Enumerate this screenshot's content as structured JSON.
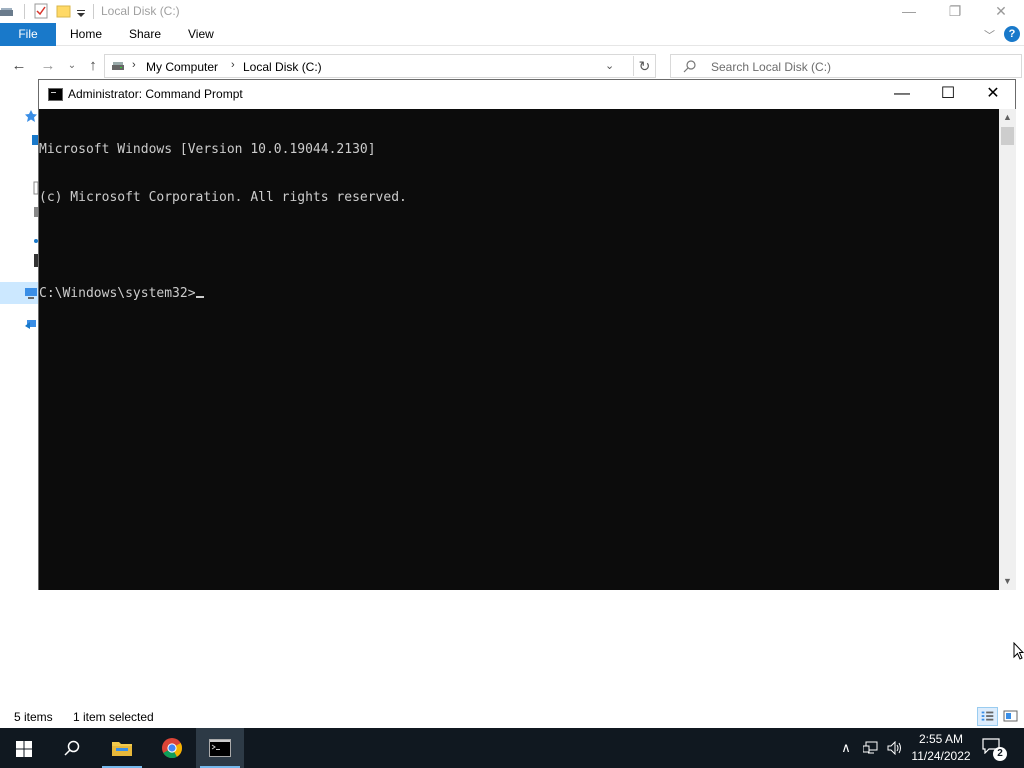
{
  "explorer": {
    "title": "Local Disk (C:)",
    "ribbon_tabs": {
      "file": "File",
      "home": "Home",
      "share": "Share",
      "view": "View"
    },
    "breadcrumb": [
      "My Computer",
      "Local Disk (C:)"
    ],
    "search_placeholder": "Search Local Disk (C:)",
    "status": {
      "items": "5 items",
      "selected": "1 item selected"
    }
  },
  "cmd": {
    "title": "Administrator: Command Prompt",
    "lines": [
      "Microsoft Windows [Version 10.0.19044.2130]",
      "(c) Microsoft Corporation. All rights reserved.",
      "",
      "C:\\Windows\\system32>"
    ]
  },
  "taskbar": {
    "apps": [
      "start-icon",
      "search-icon",
      "file-explorer-icon",
      "chrome-icon",
      "command-prompt-icon"
    ],
    "clock_time": "2:55 AM",
    "clock_date": "11/24/2022",
    "notification_count": "2"
  },
  "colors": {
    "taskbar": "#101820",
    "console_bg": "#0c0c0c",
    "console_text": "#cccccc",
    "accent": "#1979ca"
  }
}
